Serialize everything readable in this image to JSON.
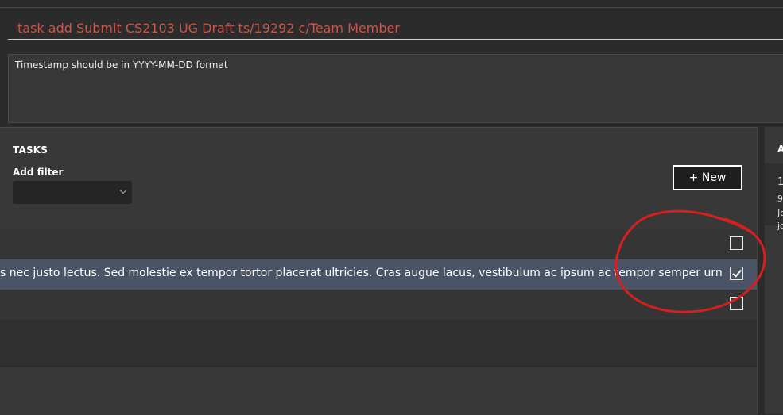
{
  "command_box": {
    "text": "task add Submit CS2103 UG Draft ts/19292 c/Team Member"
  },
  "result_box": {
    "message": "Timestamp should be in YYYY-MM-DD format"
  },
  "tasks_panel": {
    "title": "TASKS",
    "filter_label": "Add filter",
    "filter_value": "",
    "new_button": "+ New",
    "rows": [
      {
        "text": "",
        "checked": false
      },
      {
        "text": "s nec justo lectus. Sed molestie ex tempor tortor placerat ultricies. Cras augue lacus, vestibulum ac ipsum ac tempor semper urn",
        "checked": true
      },
      {
        "text": "",
        "checked": false
      }
    ]
  },
  "side_panel": {
    "title": "A",
    "line1": "1",
    "line2": "9",
    "line3": "Jo",
    "line4": "jo"
  },
  "colors": {
    "annotation": "#d42020",
    "selected_row": "#4a5466",
    "command_text": "#c6584d"
  }
}
